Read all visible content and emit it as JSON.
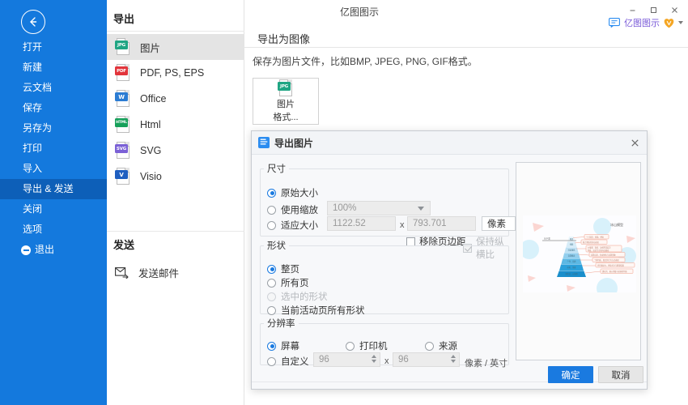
{
  "window": {
    "title": "亿图图示",
    "minimize": "–",
    "maximize": "□",
    "close": "✕"
  },
  "account": {
    "chat_icon": "chat-icon",
    "name": "亿图图示",
    "vip_icon": "vip-diamond-icon",
    "caret": "chevron-down-icon",
    "name_color": "#7a5bd8",
    "vip_color": "#f5a623"
  },
  "sidebar": {
    "back_icon": "back-arrow-icon",
    "accent": "#1479dd",
    "selected_bg": "#0d5fb8",
    "items": [
      {
        "label": "打开",
        "selected": false
      },
      {
        "label": "新建",
        "selected": false
      },
      {
        "label": "云文档",
        "selected": false
      },
      {
        "label": "保存",
        "selected": false
      },
      {
        "label": "另存为",
        "selected": false
      },
      {
        "label": "打印",
        "selected": false
      },
      {
        "label": "导入",
        "selected": false
      },
      {
        "label": "导出 & 发送",
        "selected": true
      },
      {
        "label": "关闭",
        "selected": false
      },
      {
        "label": "选项",
        "selected": false
      }
    ],
    "exit": {
      "label": "退出",
      "icon": "exit-icon"
    }
  },
  "export_panel": {
    "title": "导出",
    "items": [
      {
        "label": "图片",
        "badge": "JPG",
        "badge_color": "#1fa583",
        "active": true
      },
      {
        "label": "PDF, PS, EPS",
        "badge": "PDF",
        "badge_color": "#e2343b",
        "active": false
      },
      {
        "label": "Office",
        "badge": "W",
        "badge_color": "#2b7cd3",
        "active": false
      },
      {
        "label": "Html",
        "badge": "HTML",
        "badge_color": "#16a05a",
        "active": false
      },
      {
        "label": "SVG",
        "badge": "SVG",
        "badge_color": "#7b61d6",
        "active": false
      },
      {
        "label": "Visio",
        "badge": "V",
        "badge_color": "#1f5fc0",
        "active": false
      }
    ],
    "send_title": "发送",
    "send_mail": {
      "label": "发送邮件",
      "icon": "send-mail-icon"
    }
  },
  "content": {
    "heading": "导出为图像",
    "description": "保存为图片文件，比如BMP, JPEG, PNG, GIF格式。",
    "format_card": {
      "badge": "JPG",
      "badge_color": "#1fa583",
      "line1": "图片",
      "line2": "格式..."
    }
  },
  "dialog": {
    "icon": "export-image-icon",
    "title": "导出图片",
    "close_icon": "close-icon",
    "size_group": {
      "legend": "尺寸",
      "options": [
        {
          "label": "原始大小",
          "selected": true,
          "disabled": false
        },
        {
          "label": "使用缩放",
          "selected": false,
          "disabled": false
        },
        {
          "label": "适应大小",
          "selected": false,
          "disabled": false
        }
      ],
      "scale_value": "100%",
      "width_value": "1122.52",
      "height_value": "793.701",
      "x_separator": "x",
      "unit_value": "像素",
      "checkboxes": [
        {
          "label": "移除页边距",
          "checked": false,
          "disabled": false
        },
        {
          "label": "保持纵横比",
          "checked": true,
          "disabled": true
        }
      ]
    },
    "shape_group": {
      "legend": "形状",
      "options": [
        {
          "label": "整页",
          "selected": true,
          "disabled": false
        },
        {
          "label": "所有页",
          "selected": false,
          "disabled": false
        },
        {
          "label": "选中的形状",
          "selected": false,
          "disabled": true
        },
        {
          "label": "当前活动页所有形状",
          "selected": false,
          "disabled": false
        }
      ]
    },
    "resolution_group": {
      "legend": "分辨率",
      "options": [
        {
          "label": "屏幕",
          "selected": true,
          "disabled": false
        },
        {
          "label": "打印机",
          "selected": false,
          "disabled": false
        },
        {
          "label": "来源",
          "selected": false,
          "disabled": false
        },
        {
          "label": "自定义",
          "selected": false,
          "disabled": false
        }
      ],
      "dpi_x": "96",
      "dpi_y": "96",
      "x_separator": "x",
      "unit_label": "像素 / 英寸"
    },
    "preview": {
      "name": "export-preview"
    },
    "ok_button": "确定",
    "cancel_button": "取消"
  }
}
